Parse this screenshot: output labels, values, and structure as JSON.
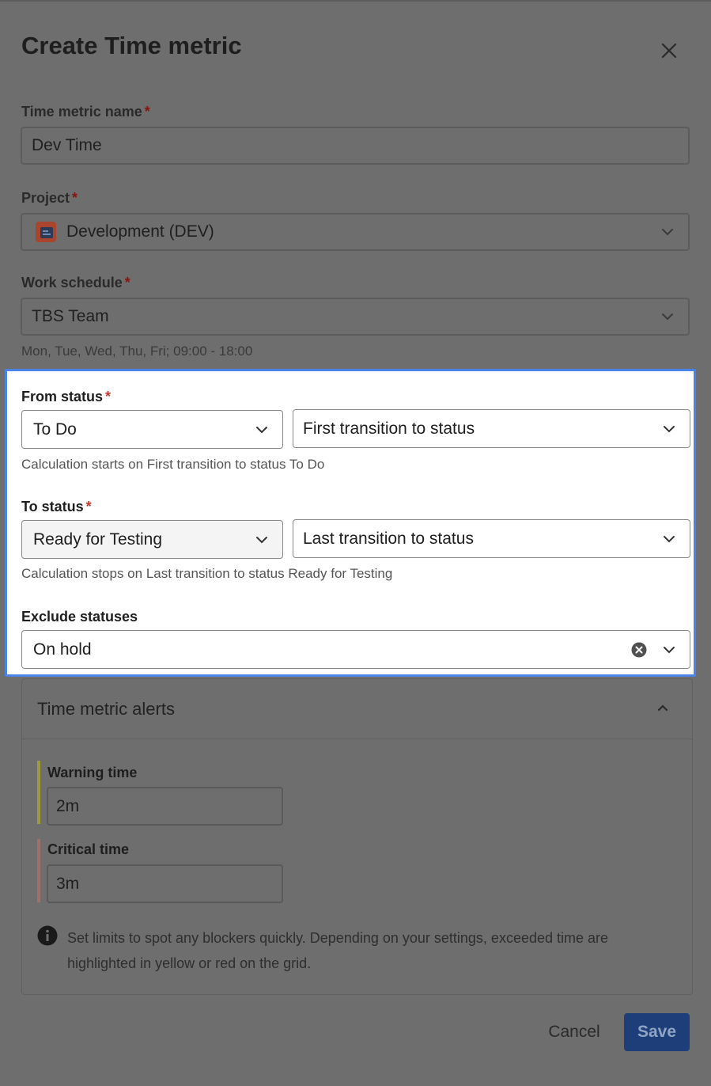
{
  "dialog": {
    "title": "Create Time metric",
    "close_icon": "close-icon"
  },
  "required_mark": "*",
  "fields": {
    "name": {
      "label": "Time metric name",
      "value": "Dev Time"
    },
    "project": {
      "label": "Project",
      "value": "Development (DEV)",
      "icon": "project-avatar-icon"
    },
    "schedule": {
      "label": "Work schedule",
      "value": "TBS Team",
      "hint": "Mon, Tue, Wed, Thu, Fri; 09:00 - 18:00"
    }
  },
  "status_panel": {
    "from": {
      "label": "From status",
      "status": "To Do",
      "mode": "First transition to status",
      "hint": "Calculation starts on First transition to status To Do"
    },
    "to": {
      "label": "To status",
      "status": "Ready for Testing",
      "mode": "Last transition to status",
      "hint": "Calculation stops on Last transition to status Ready for Testing"
    },
    "exclude": {
      "label": "Exclude statuses",
      "value": "On hold"
    },
    "highlight_color": "#4a84e8"
  },
  "alerts": {
    "title": "Time metric alerts",
    "warning": {
      "label": "Warning time",
      "value": "2m",
      "color": "#9e9a3f"
    },
    "critical": {
      "label": "Critical time",
      "value": "3m",
      "color": "#a0706c"
    },
    "info": "Set limits to spot any blockers quickly. Depending on your settings, exceeded time are highlighted in yellow or red on the grid."
  },
  "footer": {
    "cancel_label": "Cancel",
    "save_label": "Save",
    "save_color": "#1d3e78"
  }
}
